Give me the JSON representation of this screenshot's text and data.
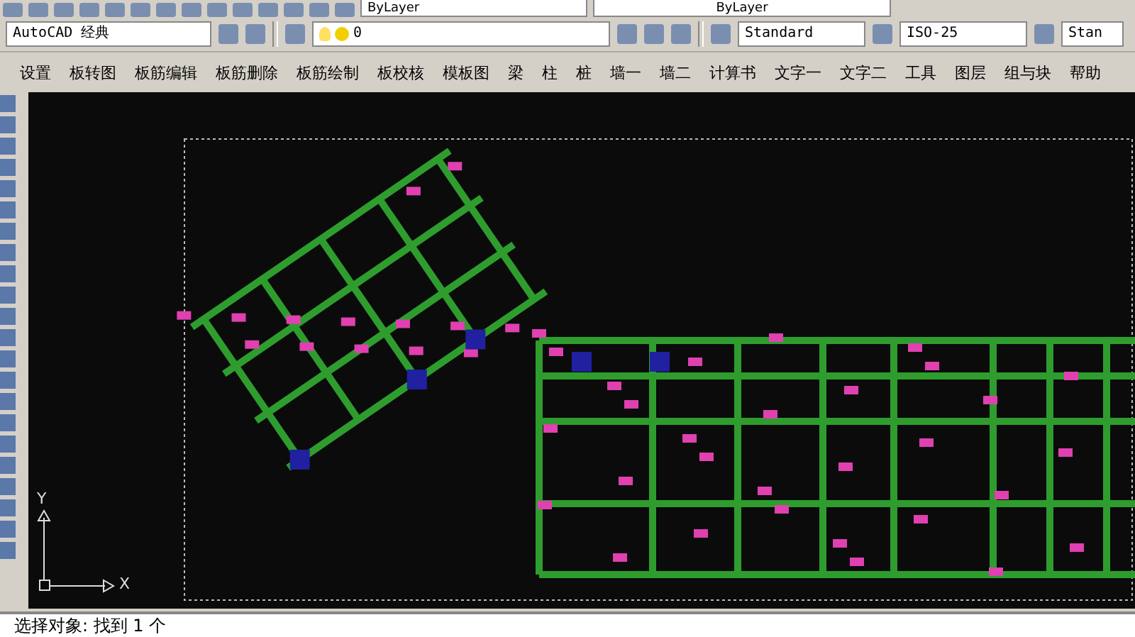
{
  "toolbar_top": {
    "color_dropdown": "ByLayer",
    "linetype_dropdown": "ByLayer"
  },
  "workspace": {
    "value": "AutoCAD 经典"
  },
  "layer": {
    "value": "0"
  },
  "text_style": {
    "value": "Standard"
  },
  "dim_style": {
    "value": "ISO-25"
  },
  "table_style": {
    "value": "Stan"
  },
  "menu": [
    "设置",
    "板转图",
    "板筋编辑",
    "板筋删除",
    "板筋绘制",
    "板校核",
    "模板图",
    "梁",
    "柱",
    "桩",
    "墙一",
    "墙二",
    "计算书",
    "文字一",
    "文字二",
    "工具",
    "图层",
    "组与块",
    "帮助"
  ],
  "canvas": {
    "ucs": {
      "x_label": "X",
      "y_label": "Y"
    }
  },
  "command_line": {
    "text": "选择对象: 找到 1 个"
  }
}
